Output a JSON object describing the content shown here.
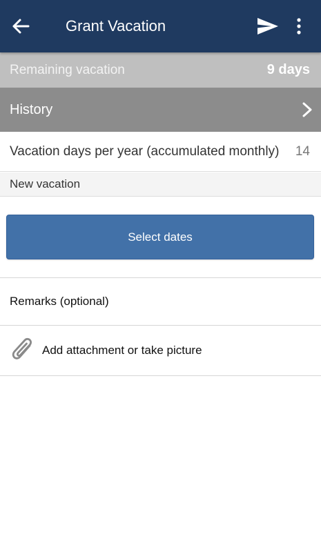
{
  "appbar": {
    "title": "Grant Vacation",
    "back_icon": "arrow-left-icon",
    "send_icon": "send-icon",
    "more_icon": "more-vertical-icon",
    "background": "#1f3a60"
  },
  "remaining": {
    "label": "Remaining vacation",
    "value": "9 days"
  },
  "history": {
    "label": "History",
    "icon": "chevron-right-icon"
  },
  "per_year": {
    "label": "Vacation days per year (accumulated monthly)",
    "value": "14"
  },
  "new_vacation": {
    "section_label": "New vacation",
    "select_dates_label": "Select dates",
    "button_color": "#4271a8"
  },
  "remarks": {
    "label": "Remarks (optional)"
  },
  "attachment": {
    "label": "Add attachment or take picture",
    "icon": "paperclip-icon"
  }
}
